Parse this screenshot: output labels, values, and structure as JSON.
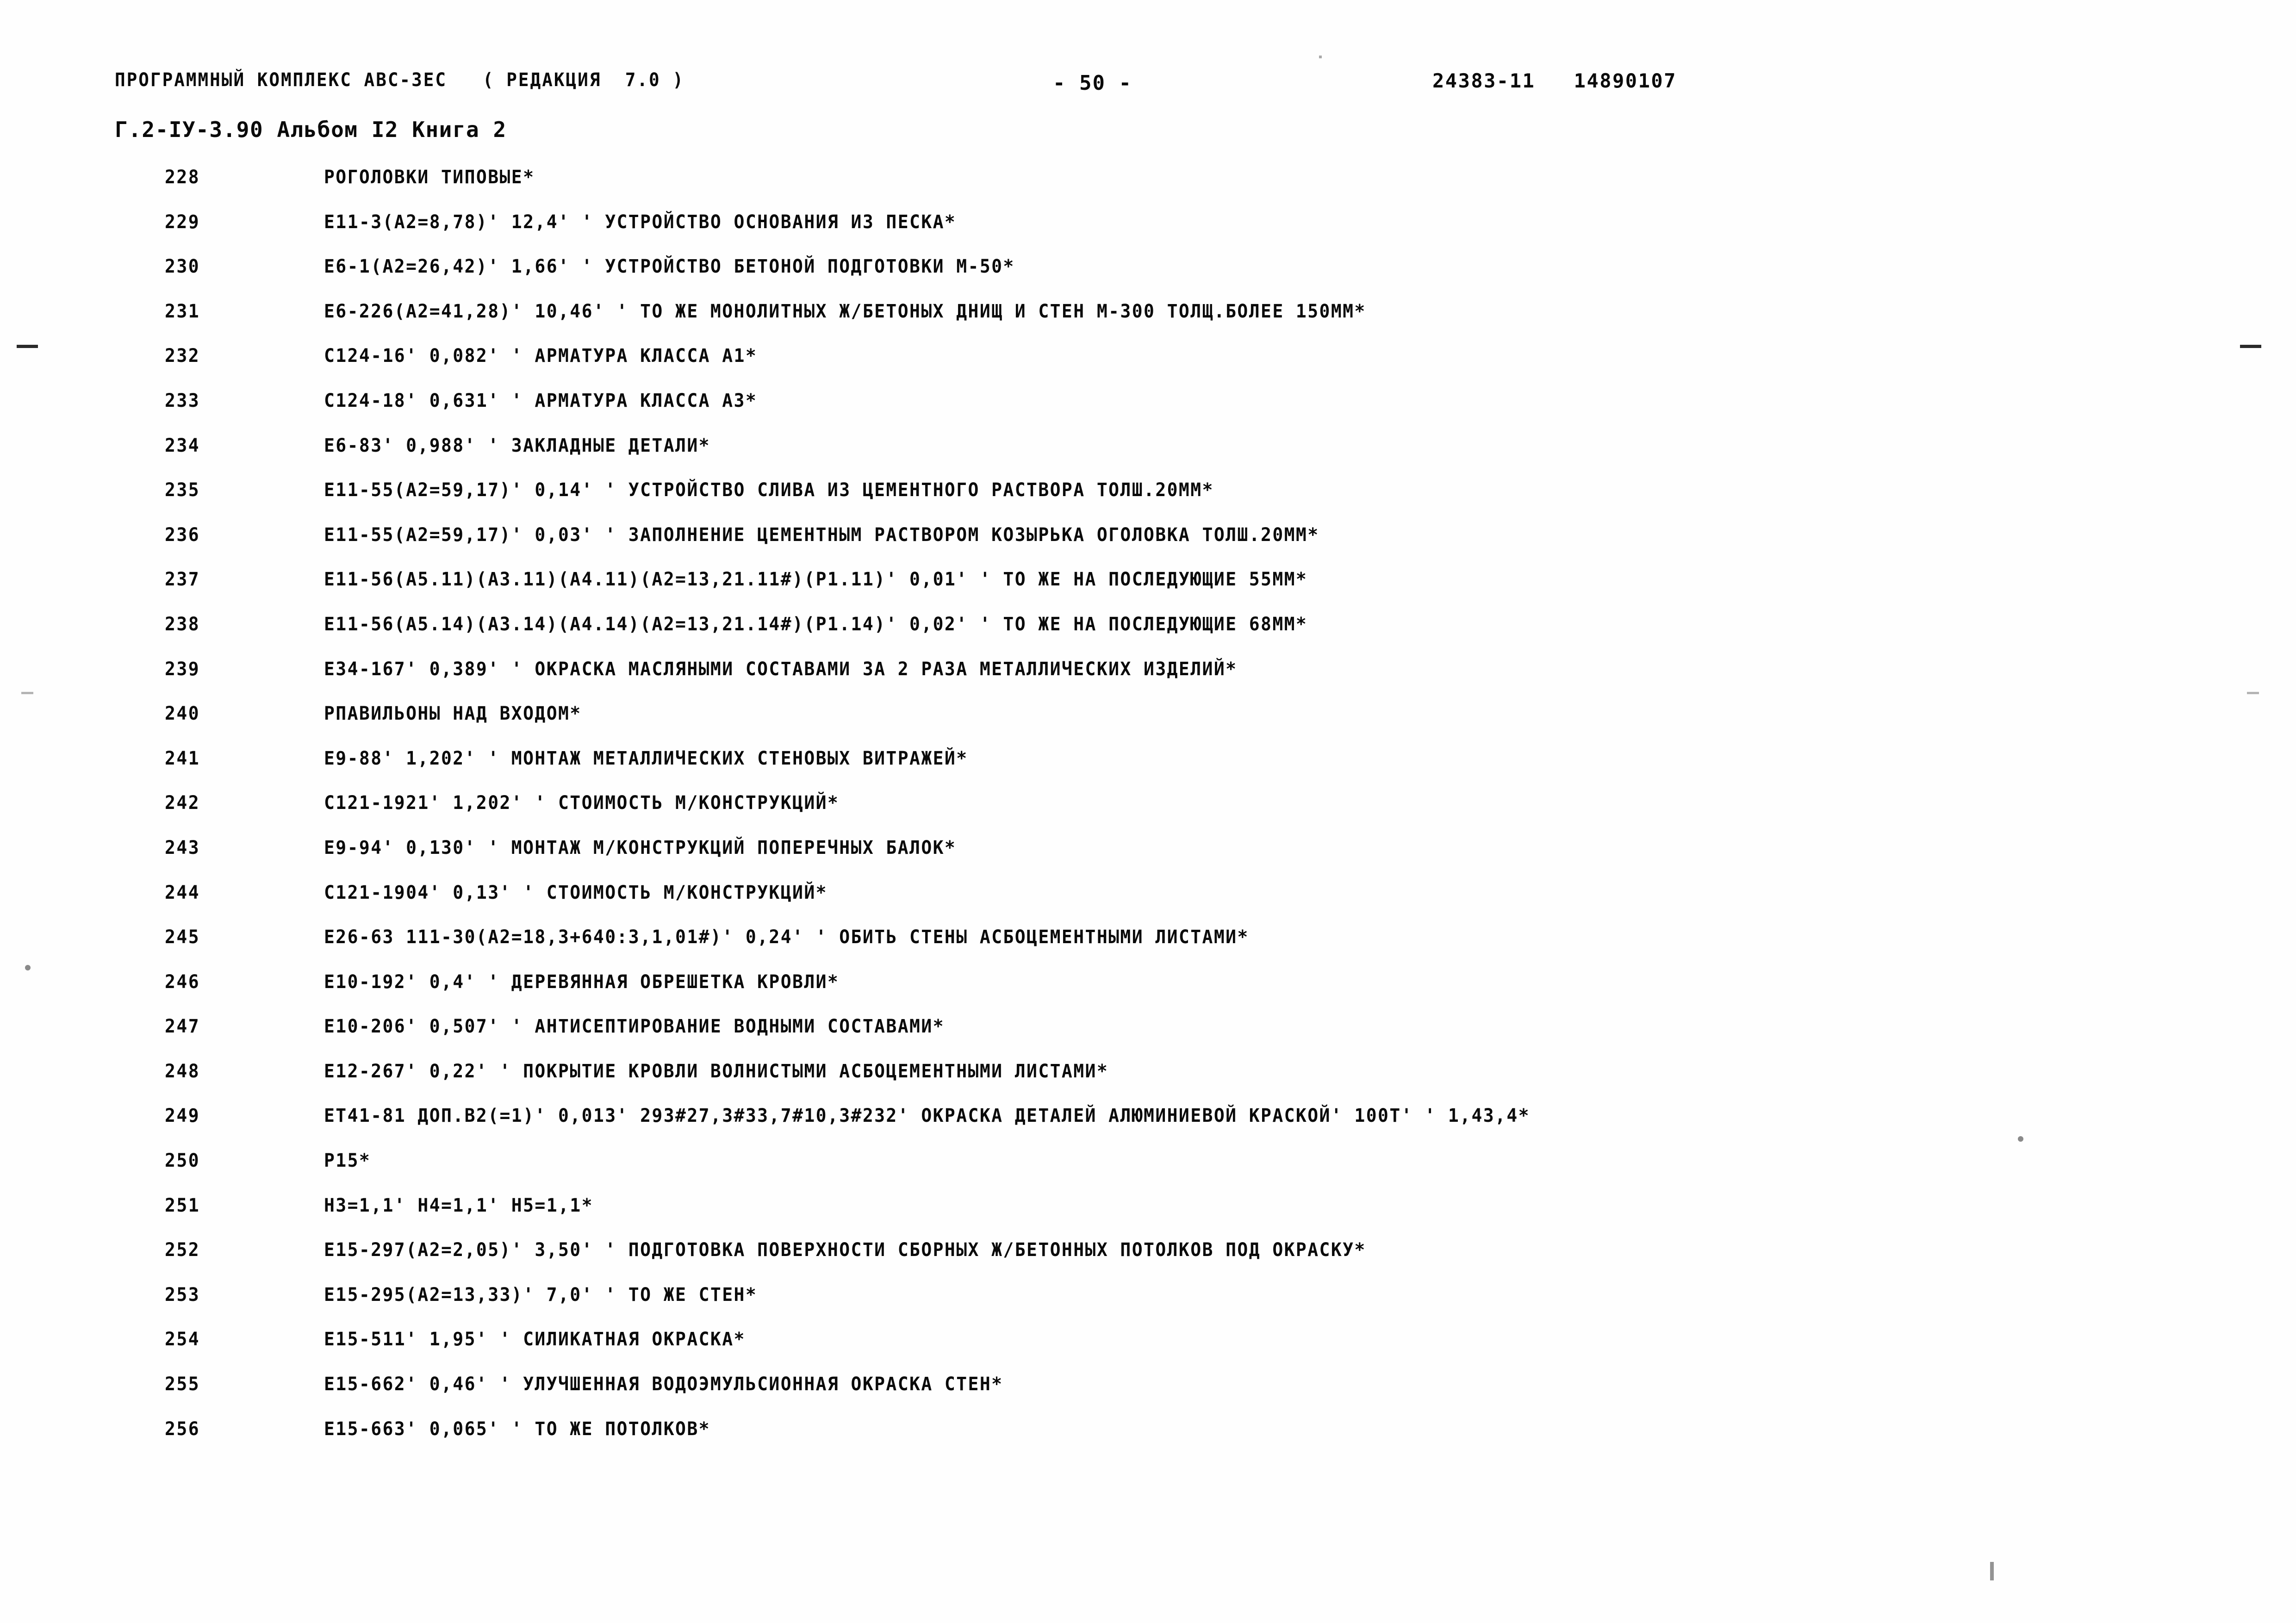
{
  "document": {
    "header": {
      "program_line": "ПРОГРАММНЫЙ КОМПЛЕКС АВС-3ЕС   ( РЕДАКЦИЯ  7.0 )",
      "page_number": "- 50 -",
      "doc_code": "24383-11",
      "job_code": "14890107",
      "subtitle": "Г.2-ІУ-3.90 Альбом І2 Книга 2"
    },
    "listing": [
      {
        "num": "228",
        "text": "РОГОЛОВКИ ТИПОВЫЕ*"
      },
      {
        "num": "229",
        "text": "Е11-3(А2=8,78)' 12,4' ' УСТРОЙСТВО ОСНОВАНИЯ ИЗ ПЕСКА*"
      },
      {
        "num": "230",
        "text": "Е6-1(А2=26,42)' 1,66' ' УСТРОЙСТВО БЕТОНОЙ ПОДГОТОВКИ М-50*"
      },
      {
        "num": "231",
        "text": "Е6-226(А2=41,28)' 10,46' ' ТО ЖЕ МОНОЛИТНЫХ Ж/БЕТОНЫХ ДНИЩ И СТЕН М-300 ТОЛЩ.БОЛЕЕ 150ММ*"
      },
      {
        "num": "232",
        "text": "С124-16' 0,082' ' АРМАТУРА КЛАССА А1*"
      },
      {
        "num": "233",
        "text": "С124-18' 0,631' ' АРМАТУРА КЛАССА А3*"
      },
      {
        "num": "234",
        "text": "Е6-83' 0,988' ' ЗАКЛАДНЫЕ ДЕТАЛИ*"
      },
      {
        "num": "235",
        "text": "Е11-55(А2=59,17)' 0,14' ' УСТРОЙСТВО СЛИВА ИЗ ЦЕМЕНТНОГО РАСТВОРА ТОЛШ.20ММ*"
      },
      {
        "num": "236",
        "text": "Е11-55(А2=59,17)' 0,03' ' ЗАПОЛНЕНИЕ ЦЕМЕНТНЫМ РАСТВОРОМ КОЗЫРЬКА ОГОЛОВКА ТОЛШ.20ММ*"
      },
      {
        "num": "237",
        "text": "Е11-56(А5.11)(А3.11)(А4.11)(А2=13,21.11#)(Р1.11)' 0,01' ' ТО ЖЕ НА ПОСЛЕДУЮЩИЕ 55ММ*"
      },
      {
        "num": "238",
        "text": "Е11-56(А5.14)(А3.14)(А4.14)(А2=13,21.14#)(Р1.14)' 0,02' ' ТО ЖЕ НА ПОСЛЕДУЮЩИЕ 68ММ*"
      },
      {
        "num": "239",
        "text": "Е34-167' 0,389' ' ОКРАСКА МАСЛЯНЫМИ СОСТАВАМИ ЗА 2 РАЗА МЕТАЛЛИЧЕСКИХ ИЗДЕЛИЙ*"
      },
      {
        "num": "240",
        "text": "РПАВИЛЬОНЫ НАД ВХОДОМ*"
      },
      {
        "num": "241",
        "text": "Е9-88' 1,202' ' МОНТАЖ МЕТАЛЛИЧЕСКИХ СТЕНОВЫХ ВИТРАЖЕЙ*"
      },
      {
        "num": "242",
        "text": "С121-1921' 1,202' ' СТОИМОСТЬ М/КОНСТРУКЦИЙ*"
      },
      {
        "num": "243",
        "text": "Е9-94' 0,130' ' МОНТАЖ М/КОНСТРУКЦИЙ ПОПЕРЕЧНЫХ БАЛОК*"
      },
      {
        "num": "244",
        "text": "С121-1904' 0,13' ' СТОИМОСТЬ М/КОНСТРУКЦИЙ*"
      },
      {
        "num": "245",
        "text": "Е26-63 111-30(А2=18,3+640:3,1,01#)' 0,24' ' ОБИТЬ СТЕНЫ АСБОЦЕМЕНТНЫМИ ЛИСТАМИ*"
      },
      {
        "num": "246",
        "text": "Е10-192' 0,4' ' ДЕРЕВЯННАЯ ОБРЕШЕТКА КРОВЛИ*"
      },
      {
        "num": "247",
        "text": "Е10-206' 0,507' ' АНТИСЕПТИРОВАНИЕ ВОДНЫМИ СОСТАВАМИ*"
      },
      {
        "num": "248",
        "text": "Е12-267' 0,22' ' ПОКРЫТИЕ КРОВЛИ ВОЛНИСТЫМИ АСБОЦЕМЕНТНЫМИ ЛИСТАМИ*"
      },
      {
        "num": "249",
        "text": "ЕТ41-81 ДОП.В2(=1)' 0,013' 293#27,3#33,7#10,3#232' ОКРАСКА ДЕТАЛЕЙ АЛЮМИНИЕВОЙ КРАСКОЙ' 100Т' ' 1,43,4*"
      },
      {
        "num": "250",
        "text": "Р15*"
      },
      {
        "num": "251",
        "text": "Н3=1,1' Н4=1,1' Н5=1,1*"
      },
      {
        "num": "252",
        "text": "Е15-297(А2=2,05)' 3,50' ' ПОДГОТОВКА ПОВЕРХНОСТИ СБОРНЫХ Ж/БЕТОННЫХ ПОТОЛКОВ ПОД ОКРАСКУ*"
      },
      {
        "num": "253",
        "text": "Е15-295(А2=13,33)' 7,0' ' ТО ЖЕ СТЕН*"
      },
      {
        "num": "254",
        "text": "Е15-511' 1,95' ' СИЛИКАТНАЯ ОКРАСКА*"
      },
      {
        "num": "255",
        "text": "Е15-662' 0,46' ' УЛУЧШЕННАЯ ВОДОЭМУЛЬСИОННАЯ ОКРАСКА СТЕН*"
      },
      {
        "num": "256",
        "text": "Е15-663' 0,065' ' ТО ЖЕ ПОТОЛКОВ*"
      }
    ]
  }
}
